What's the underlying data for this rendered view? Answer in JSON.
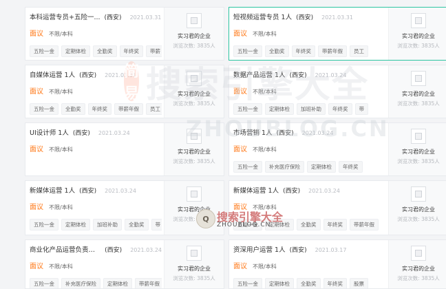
{
  "jobs": [
    {
      "title": "本科运营专员+五险一...",
      "city": "(西安)",
      "date": "2021.03.31",
      "salary": "面议",
      "edu": "不限/本科",
      "tags": [
        "五险一金",
        "定期体检",
        "全勤奖",
        "年终奖",
        "带薪"
      ],
      "company": "实习君的企业",
      "views": "浏览次数: 3835人"
    },
    {
      "title": "短视频运营专员 1人",
      "city": "(西安)",
      "date": "2021.03.31",
      "salary": "面议",
      "edu": "不限/本科",
      "tags": [
        "五险一金",
        "全勤奖",
        "年终奖",
        "带薪年假",
        "员工"
      ],
      "company": "实习君的企业",
      "views": "浏览次数: 3835人"
    },
    {
      "title": "自媒体运营 1人",
      "city": "(西安)",
      "date": "2021.03.31",
      "salary": "面议",
      "edu": "不限/本科",
      "tags": [
        "五险一金",
        "全勤奖",
        "年终奖",
        "带薪年假",
        "员工"
      ],
      "company": "实习君的企业",
      "views": "浏览次数: 3835人"
    },
    {
      "title": "数据产品运营 1人",
      "city": "(西安)",
      "date": "2021.03.24",
      "salary": "面议",
      "edu": "不限/本科",
      "tags": [
        "五险一金",
        "定期体检",
        "加班补助",
        "年终奖",
        "带"
      ],
      "company": "实习君的企业",
      "views": "浏览次数: 3835人"
    },
    {
      "title": "UI设计师 1人",
      "city": "(西安)",
      "date": "2021.03.24",
      "salary": "面议",
      "edu": "不限/本科",
      "tags": [],
      "company": "实习君的企业",
      "views": "浏览次数: 3835人"
    },
    {
      "title": "市场营销 1人",
      "city": "(西安)",
      "date": "2021.03.24",
      "salary": "面议",
      "edu": "不限/本科",
      "tags": [
        "五险一金",
        "补充医疗保险",
        "定期体检",
        "年终奖"
      ],
      "company": "实习君的企业",
      "views": "浏览次数: 3835人"
    },
    {
      "title": "新媒体运营 1人",
      "city": "(西安)",
      "date": "2021.03.24",
      "salary": "面议",
      "edu": "不限/本科",
      "tags": [
        "五险一金",
        "定期体检",
        "加班补助",
        "全勤奖",
        "带"
      ],
      "company": "实习君的企业",
      "views": "浏览次数: 3835人"
    },
    {
      "title": "新媒体运营 1人",
      "city": "(西安)",
      "date": "2021.03.24",
      "salary": "面议",
      "edu": "不限/本科",
      "tags": [
        "五险一金",
        "定期体检",
        "全勤奖",
        "年终奖",
        "带薪年假"
      ],
      "company": "实习君的企业",
      "views": "浏览次数: 3835人"
    },
    {
      "title": "商业化产品运营负责人...",
      "city": "(西安)",
      "date": "2021.03.24",
      "salary": "面议",
      "edu": "不限/本科",
      "tags": [
        "五险一金",
        "补充医疗保险",
        "定期体检",
        "带薪年假"
      ],
      "company": "实习君的企业",
      "views": "浏览次数: 3835人"
    },
    {
      "title": "资深用户运营 1人",
      "city": "(西安)",
      "date": "2021.03.17",
      "salary": "面议",
      "edu": "不限/本科",
      "tags": [
        "五险一金",
        "定期体检",
        "全勤奖",
        "年终奖",
        "股票"
      ],
      "company": "实习君的企业",
      "views": "浏览次数: 3835人"
    }
  ],
  "watermark": {
    "badge": "简易",
    "text": "搜索引擎大全",
    "url": "ZHOUBLOG.CN",
    "small_badge": "Q",
    "small_text": "搜索引擎大全",
    "small_url": "ZHOUBLOG.CN"
  },
  "colors": {
    "salary": "#ff7a1a",
    "active_border": "#2cc5a0"
  }
}
